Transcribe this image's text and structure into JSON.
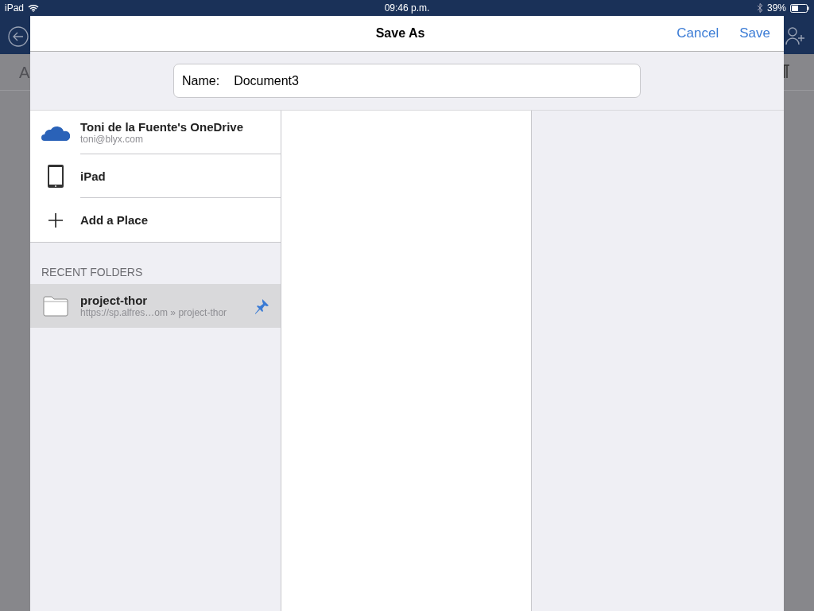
{
  "status_bar": {
    "device": "iPad",
    "time": "09:46 p.m.",
    "battery": "39%"
  },
  "background_toolbar": {
    "format_label": "A"
  },
  "dialog": {
    "title": "Save As",
    "cancel": "Cancel",
    "save": "Save",
    "name_field": {
      "label": "Name:",
      "value": "Document3"
    },
    "places": [
      {
        "kind": "cloud",
        "title": "Toni de la Fuente's OneDrive",
        "subtitle": "toni@blyx.com"
      },
      {
        "kind": "device",
        "title": "iPad"
      },
      {
        "kind": "add",
        "title": "Add a Place"
      }
    ],
    "recent_heading": "RECENT FOLDERS",
    "recent_folders": [
      {
        "title": "project-thor",
        "path": "https://sp.alfres…om » project-thor",
        "selected": true,
        "pinned": true
      }
    ]
  }
}
